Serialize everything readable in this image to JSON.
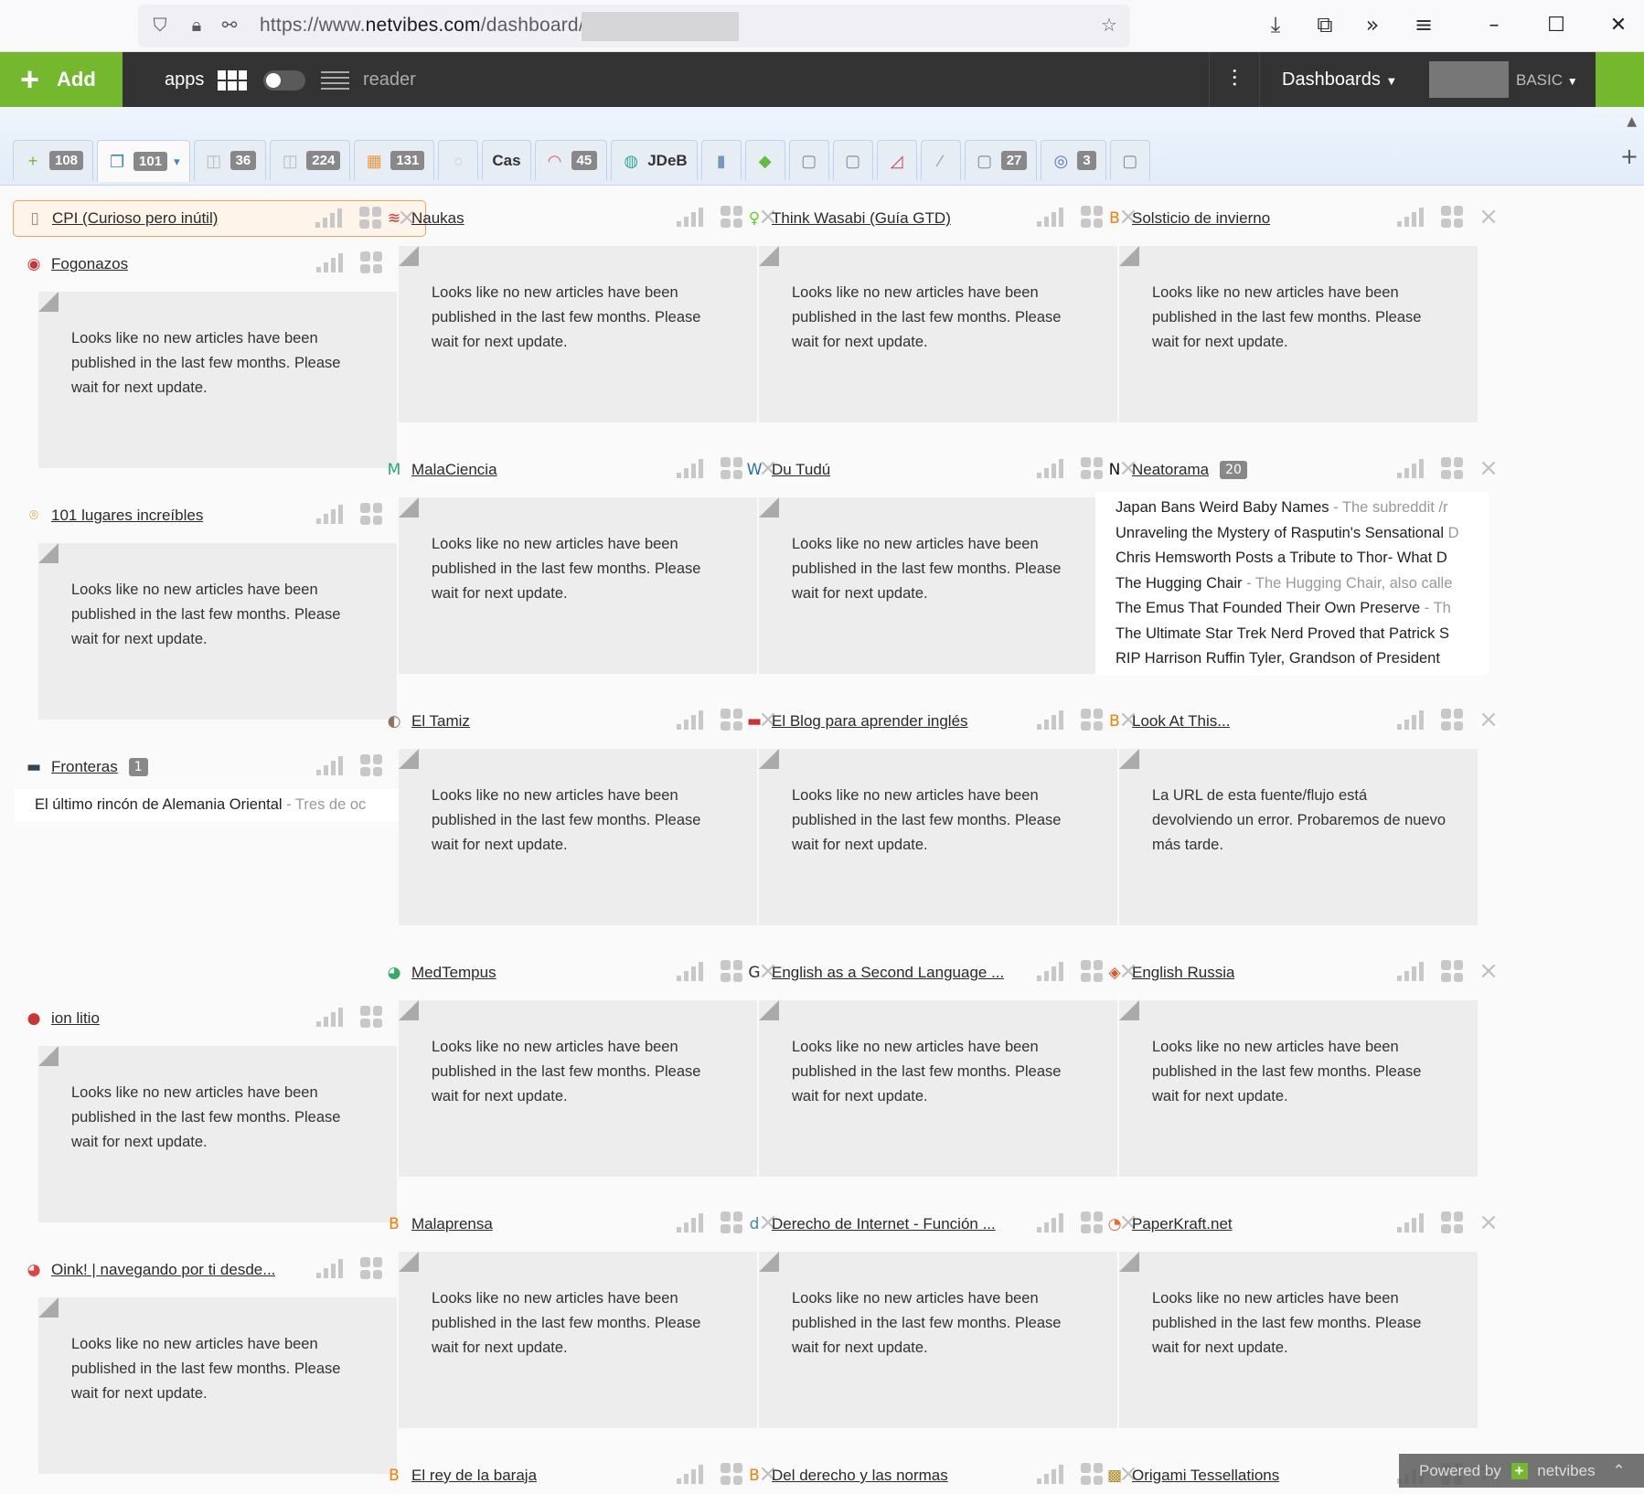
{
  "browser": {
    "url_prefix": "https://www.",
    "url_domain": "netvibes.com",
    "url_path": "/dashboard/"
  },
  "topbar": {
    "add_label": "Add",
    "apps_label": "apps",
    "reader_label": "reader",
    "dashboards_label": "Dashboards",
    "plan_label": "BASIC",
    "accent": "#73b82d"
  },
  "tabs": [
    {
      "icon": "+",
      "icon_color": "#73b82d",
      "count": "108",
      "name": ""
    },
    {
      "icon": "❐",
      "icon_color": "#3b7ddd",
      "count": "101",
      "name": "",
      "active": true,
      "dropdown": "▾"
    },
    {
      "icon": "◫",
      "icon_color": "#bbb",
      "count": "36",
      "name": ""
    },
    {
      "icon": "◫",
      "icon_color": "#bbb",
      "count": "224",
      "name": ""
    },
    {
      "icon": "▦",
      "icon_color": "#e94",
      "count": "131",
      "name": ""
    },
    {
      "icon": "○",
      "icon_color": "#ccc",
      "count": "",
      "name": ""
    },
    {
      "icon": "",
      "icon_color": "#fff",
      "count": "",
      "name": "Cas"
    },
    {
      "icon": "◠",
      "icon_color": "#e55",
      "count": "45",
      "name": ""
    },
    {
      "icon": "◍",
      "icon_color": "#3a9",
      "count": "",
      "name": "JDeB"
    },
    {
      "icon": "▮",
      "icon_color": "#79b",
      "count": "",
      "name": ""
    },
    {
      "icon": "◆",
      "icon_color": "#6b4",
      "count": "",
      "name": ""
    },
    {
      "icon": "▢",
      "icon_color": "#888",
      "count": "",
      "name": ""
    },
    {
      "icon": "▢",
      "icon_color": "#888",
      "count": "",
      "name": ""
    },
    {
      "icon": "◿",
      "icon_color": "#c44",
      "count": "",
      "name": ""
    },
    {
      "icon": "∕",
      "icon_color": "#999",
      "count": "",
      "name": ""
    },
    {
      "icon": "▢",
      "icon_color": "#888",
      "count": "27",
      "name": ""
    },
    {
      "icon": "◎",
      "icon_color": "#57c",
      "count": "3",
      "name": ""
    },
    {
      "icon": "▢",
      "icon_color": "#888",
      "count": "",
      "name": ""
    }
  ],
  "messages": {
    "no_articles": "Looks like no new articles have been published in the last few months. Please wait for next update.",
    "url_error": "La URL de esta fuente/flujo está devolviendo un error. Probaremos de nuevo más tarde."
  },
  "columns": [
    [
      {
        "title": "CPI (Curioso pero inútil)",
        "icon": "▯",
        "icon_color": "#888",
        "type": "header-only",
        "highlight": true
      },
      {
        "title": "Fogonazos",
        "icon": "◉",
        "icon_color": "#c33",
        "type": "empty",
        "offset": -231
      },
      {
        "title": "101 lugares increíbles",
        "icon": "⌾",
        "icon_color": "#f0a040",
        "type": "empty"
      },
      {
        "title": "Fronteras",
        "icon": "▬",
        "icon_color": "#345",
        "type": "list",
        "count": "1",
        "items": [
          {
            "title": "El último rincón de Alemania Oriental",
            "snippet": " - Tres de oc"
          }
        ],
        "height": 275
      },
      {
        "title": "",
        "type": "spacer"
      },
      {
        "title": "ion litio",
        "icon": "●",
        "icon_color": "#c33",
        "type": "empty"
      },
      {
        "title": "Oink! | navegando por ti desde...",
        "icon": "◕",
        "icon_color": "#d44",
        "type": "empty"
      }
    ],
    [
      {
        "title": "Naukas",
        "icon": "≋",
        "icon_color": "#c33",
        "type": "empty"
      },
      {
        "title": "MalaCiencia",
        "icon": "M",
        "icon_color": "#2a7",
        "type": "empty"
      },
      {
        "title": "El Tamiz",
        "icon": "◐",
        "icon_color": "#876",
        "type": "empty"
      },
      {
        "title": "MedTempus",
        "icon": "◕",
        "icon_color": "#3a6",
        "type": "empty"
      },
      {
        "title": "Malaprensa",
        "icon": "B",
        "icon_color": "#f57d00",
        "type": "empty"
      },
      {
        "title": "El rey de la baraja",
        "icon": "B",
        "icon_color": "#f57d00",
        "type": "header-only"
      }
    ],
    [
      {
        "title": "Think Wasabi (Guía GTD)",
        "icon": "♀",
        "icon_color": "#6c3",
        "type": "empty"
      },
      {
        "title": "Du Tudú",
        "icon": "W",
        "icon_color": "#2672a8",
        "type": "empty"
      },
      {
        "title": "El Blog para aprender inglés",
        "icon": "▬",
        "icon_color": "#c33",
        "type": "empty"
      },
      {
        "title": "English as a Second Language ...",
        "icon": "G",
        "icon_color": "#333",
        "type": "empty"
      },
      {
        "title": "Derecho de Internet - Función ...",
        "icon": "d",
        "icon_color": "#48a",
        "type": "empty"
      },
      {
        "title": "Del derecho y las normas",
        "icon": "B",
        "icon_color": "#f57d00",
        "type": "header-only"
      }
    ],
    [
      {
        "title": "Solsticio de invierno",
        "icon": "B",
        "icon_color": "#f57d00",
        "type": "empty"
      },
      {
        "title": "Neatorama",
        "icon": "N",
        "icon_color": "#111",
        "type": "list",
        "count": "20",
        "items": [
          {
            "title": "Japan Bans Weird Baby Names",
            "snippet": " - The subreddit /r"
          },
          {
            "title": "Unraveling the Mystery of Rasputin's Sensational",
            "snippet": " D"
          },
          {
            "title": "Chris Hemsworth Posts a Tribute to Thor- What D",
            "snippet": ""
          },
          {
            "title": "The Hugging Chair",
            "snippet": " - The Hugging Chair, also calle"
          },
          {
            "title": "The Emus That Founded Their Own Preserve",
            "snippet": " - Th"
          },
          {
            "title": "The Ultimate Star Trek Nerd Proved that Patrick S",
            "snippet": ""
          },
          {
            "title": "RIP Harrison Ruffin Tyler, Grandson of President",
            "snippet": ""
          }
        ]
      },
      {
        "title": "Look At This...",
        "icon": "B",
        "icon_color": "#f57d00",
        "type": "error"
      },
      {
        "title": "English Russia",
        "icon": "◈",
        "icon_color": "#d52",
        "type": "empty"
      },
      {
        "title": "PaperKraft.net",
        "icon": "◔",
        "icon_color": "#e63",
        "type": "empty"
      },
      {
        "title": "Origami Tessellations",
        "icon": "▩",
        "icon_color": "#a82",
        "type": "header-only"
      }
    ]
  ],
  "footer": {
    "powered_by": "Powered by",
    "brand": "netvibes"
  }
}
